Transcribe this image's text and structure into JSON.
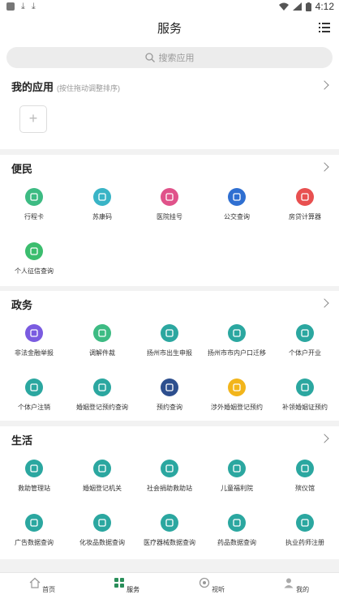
{
  "status": {
    "time": "4:12"
  },
  "header": {
    "title": "服务",
    "menu_icon": "list-menu-icon"
  },
  "search": {
    "placeholder": "搜索应用"
  },
  "my_apps": {
    "title": "我的应用",
    "hint": "(按住拖动调整排序)",
    "add": "+"
  },
  "sections": [
    {
      "title": "便民",
      "items": [
        {
          "label": "行程卡",
          "icon": "itinerary-card-icon",
          "color": "#3dbb83"
        },
        {
          "label": "苏康码",
          "icon": "health-code-icon",
          "color": "#39b4c6"
        },
        {
          "label": "医院挂号",
          "icon": "hospital-register-icon",
          "color": "#e0528a"
        },
        {
          "label": "公交查询",
          "icon": "bus-icon",
          "color": "#2f6fd1"
        },
        {
          "label": "房贷计算器",
          "icon": "house-loan-icon",
          "color": "#e85050"
        },
        {
          "label": "个人征信查询",
          "icon": "credit-check-icon",
          "color": "#3bbd6e"
        }
      ]
    },
    {
      "title": "政务",
      "items": [
        {
          "label": "非法金融举报",
          "icon": "finance-report-icon",
          "color": "#7a5be0"
        },
        {
          "label": "调解件裁",
          "icon": "handshake-icon",
          "color": "#3dbb83"
        },
        {
          "label": "扬州市出生申报",
          "icon": "birth-declare-icon",
          "color": "#2ba7a0"
        },
        {
          "label": "扬州市市内户口迁移",
          "icon": "household-move-icon",
          "color": "#2ba7a0"
        },
        {
          "label": "个体户开业",
          "icon": "shop-open-icon",
          "color": "#2ba7a0"
        },
        {
          "label": "个体户注销",
          "icon": "shop-cancel-icon",
          "color": "#2ba7a0"
        },
        {
          "label": "婚姻登记预约查询",
          "icon": "marriage-booking-icon",
          "color": "#2ba7a0"
        },
        {
          "label": "预约查询",
          "icon": "booking-query-icon",
          "color": "#2d4f8e"
        },
        {
          "label": "涉外婚姻登记预约",
          "icon": "foreign-marriage-icon",
          "color": "#f2b51b"
        },
        {
          "label": "补领婚姻证预约",
          "icon": "marriage-cert-icon",
          "color": "#2ba7a0"
        }
      ]
    },
    {
      "title": "生活",
      "items": [
        {
          "label": "救助管理站",
          "icon": "rescue-station-icon",
          "color": "#2ba7a0"
        },
        {
          "label": "婚姻登记机关",
          "icon": "marriage-office-icon",
          "color": "#2ba7a0"
        },
        {
          "label": "社会捐助救助站",
          "icon": "donation-station-icon",
          "color": "#2ba7a0"
        },
        {
          "label": "儿童福利院",
          "icon": "child-welfare-icon",
          "color": "#2ba7a0"
        },
        {
          "label": "殡仪馆",
          "icon": "funeral-home-icon",
          "color": "#2ba7a0"
        },
        {
          "label": "广告数据查询",
          "icon": "ad-query-icon",
          "color": "#2ba7a0"
        },
        {
          "label": "化妆品数据查询",
          "icon": "cosmetics-query-icon",
          "color": "#2ba7a0"
        },
        {
          "label": "医疗器械数据查询",
          "icon": "medical-device-icon",
          "color": "#2ba7a0"
        },
        {
          "label": "药品数据查询",
          "icon": "drug-query-icon",
          "color": "#2ba7a0"
        },
        {
          "label": "执业药师注册",
          "icon": "pharmacist-icon",
          "color": "#2ba7a0"
        }
      ]
    }
  ],
  "tabs": [
    {
      "label": "首页",
      "icon": "home-icon"
    },
    {
      "label": "服务",
      "icon": "grid-apps-icon",
      "active": true
    },
    {
      "label": "视听",
      "icon": "media-icon"
    },
    {
      "label": "我的",
      "icon": "profile-icon"
    }
  ]
}
